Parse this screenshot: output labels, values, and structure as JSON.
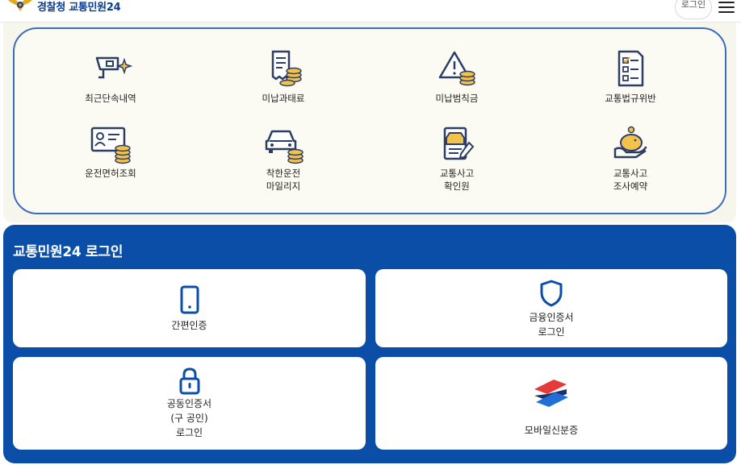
{
  "header": {
    "logo_text": "경찰청 교통민원24",
    "login_button": "로그인",
    "menu_icon": "hamburger-menu-icon"
  },
  "services": [
    {
      "label": "최근단속내역",
      "icon": "cctv-camera-icon"
    },
    {
      "label": "미납과태료",
      "icon": "receipt-coins-icon"
    },
    {
      "label": "미납범칙금",
      "icon": "warning-coins-icon"
    },
    {
      "label": "교통법규위반",
      "icon": "checklist-icon"
    },
    {
      "label": "운전면허조회",
      "icon": "license-coins-icon"
    },
    {
      "label_lines": [
        "착한운전",
        "마일리지"
      ],
      "icon": "car-coins-icon"
    },
    {
      "label_lines": [
        "교통사고",
        "확인원"
      ],
      "icon": "accident-document-icon"
    },
    {
      "label_lines": [
        "교통사고",
        "조사예약"
      ],
      "icon": "piggy-bank-hand-icon"
    }
  ],
  "login": {
    "title": "교통민원24 로그인",
    "options": [
      {
        "lines": [
          "간편인증"
        ],
        "icon": "smartphone-icon"
      },
      {
        "lines": [
          "금융인증서",
          "로그인"
        ],
        "icon": "shield-icon"
      },
      {
        "lines": [
          "공동인증서",
          "(구 공인)",
          "로그인"
        ],
        "icon": "padlock-icon"
      },
      {
        "lines": [
          "모바일신분증"
        ],
        "icon": "mobile-id-logo-icon"
      }
    ]
  },
  "colors": {
    "brand_blue": "#0a4ea8",
    "icon_navy": "#2c3e63",
    "coin_gold": "#f2c14e",
    "panel_border": "#3a6cc0"
  }
}
